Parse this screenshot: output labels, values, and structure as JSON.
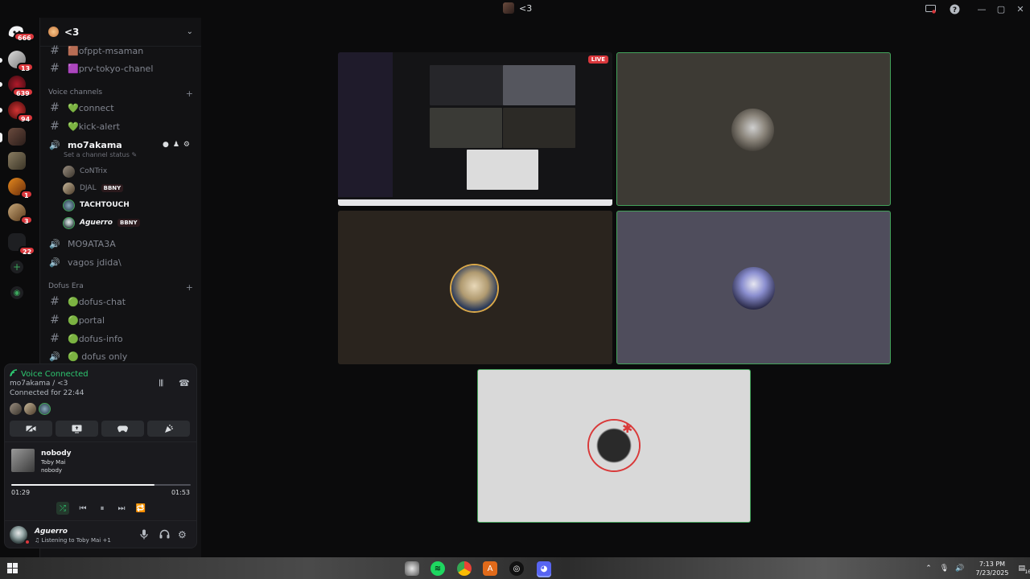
{
  "window": {
    "title": "<3",
    "icons": {
      "screen_share": "screen-share-icon",
      "help": "help-icon"
    },
    "controls": {
      "minimize": "—",
      "maximize": "▢",
      "close": "✕"
    }
  },
  "server_rail": {
    "badges": [
      "666",
      "13",
      "639",
      "94",
      "1",
      "3",
      "22"
    ]
  },
  "guild": {
    "name": "<3"
  },
  "channels": {
    "top": [
      {
        "name": "🟫ofppt-msaman"
      },
      {
        "name": "🟪prv-tokyo-chanel"
      }
    ],
    "voice_category": "Voice channels",
    "voice": [
      {
        "name": "💚connect"
      },
      {
        "name": "💚kick-alert"
      }
    ],
    "active_voice": {
      "name": "mo7akama",
      "status": "Set a channel status"
    },
    "voice_users": [
      {
        "name": "CoNTrix",
        "tag": ""
      },
      {
        "name": "DJAL",
        "tag": "BBNY"
      },
      {
        "name": "TACHTOUCH",
        "tag": ""
      },
      {
        "name": "Aguerro",
        "tag": "BBNY"
      }
    ],
    "voice_more": [
      {
        "name": "MO9ATA3A"
      },
      {
        "name": "vagos jdida\\"
      }
    ],
    "dofus_category": "Dofus Era",
    "dofus": [
      {
        "name": "🟢dofus-chat"
      },
      {
        "name": "🟢portal"
      },
      {
        "name": "🟢dofus-info"
      },
      {
        "name": "🟢 dofus only"
      }
    ]
  },
  "voice_panel": {
    "title": "Voice Connected",
    "location": "mo7akama / <3",
    "connected_for": "Connected for 22:44"
  },
  "media": {
    "title": "nobody",
    "artist": "Toby Mai",
    "album": "nobody",
    "current": "01:29",
    "total": "01:53",
    "progress": 0.8
  },
  "user": {
    "name": "Aguerro",
    "status": "♫ Listening to Toby Mai +1"
  },
  "stage": {
    "live_label": "LIVE"
  },
  "taskbar": {
    "time": "7:13 PM",
    "date": "7/23/2025",
    "notifications": "16"
  },
  "colors": {
    "accent_green": "#2dc770",
    "danger": "#da373c",
    "speaking": "#43a25a"
  }
}
